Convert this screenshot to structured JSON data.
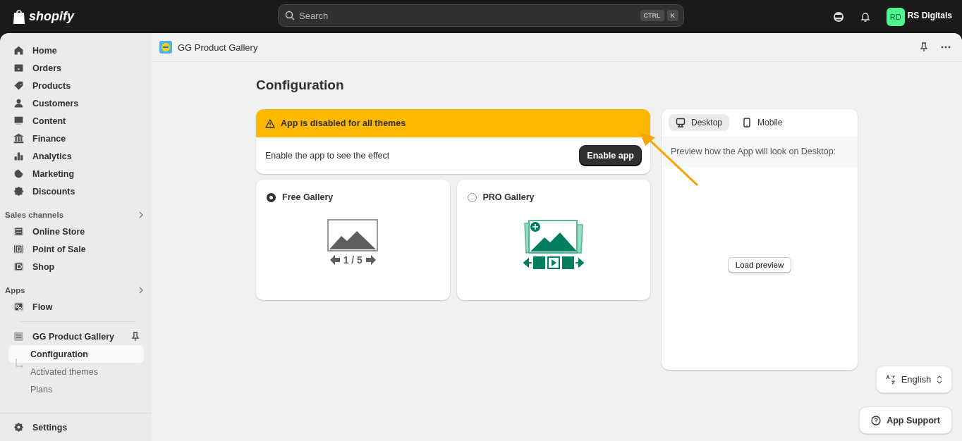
{
  "topbar": {
    "logo": "shopify",
    "search": {
      "placeholder": "Search",
      "keys": [
        "CTRL",
        "K"
      ]
    },
    "account": {
      "initials": "RD",
      "name": "RS Digitals"
    }
  },
  "sidebar": {
    "items": [
      {
        "label": "Home",
        "selected": false
      },
      {
        "label": "Orders",
        "selected": false
      },
      {
        "label": "Products",
        "selected": false
      },
      {
        "label": "Customers",
        "selected": false
      },
      {
        "label": "Content",
        "selected": false
      },
      {
        "label": "Finance",
        "selected": false
      },
      {
        "label": "Analytics",
        "selected": false
      },
      {
        "label": "Marketing",
        "selected": false
      },
      {
        "label": "Discounts",
        "selected": false
      }
    ],
    "sections": [
      {
        "title": "Sales channels",
        "items": [
          {
            "label": "Online Store",
            "selected": false
          },
          {
            "label": "Point of Sale",
            "selected": false
          },
          {
            "label": "Shop",
            "selected": false
          }
        ]
      },
      {
        "title": "Apps",
        "items": [
          {
            "label": "Flow",
            "selected": false
          }
        ]
      }
    ],
    "app": {
      "label": "GG Product Gallery",
      "children": [
        {
          "label": "Configuration",
          "selected": true
        },
        {
          "label": "Activated themes",
          "selected": false
        },
        {
          "label": "Plans",
          "selected": false
        }
      ]
    },
    "settings": "Settings"
  },
  "app_header": {
    "title": "GG Product Gallery"
  },
  "page": {
    "title": "Configuration",
    "banner": {
      "title": "App is disabled for all themes",
      "message": "Enable the app to see the effect",
      "button": "Enable app"
    },
    "galleries": [
      {
        "label": "Free Gallery",
        "selected": true,
        "kind": "free",
        "counter": "1 / 5"
      },
      {
        "label": "PRO Gallery",
        "selected": false,
        "kind": "pro"
      }
    ],
    "preview": {
      "tabs": [
        {
          "label": "Desktop",
          "selected": true
        },
        {
          "label": "Mobile",
          "selected": false
        }
      ],
      "note": "Preview how the App will look on Desktop:",
      "button": "Load preview"
    }
  },
  "language": "English",
  "support": "App Support"
}
